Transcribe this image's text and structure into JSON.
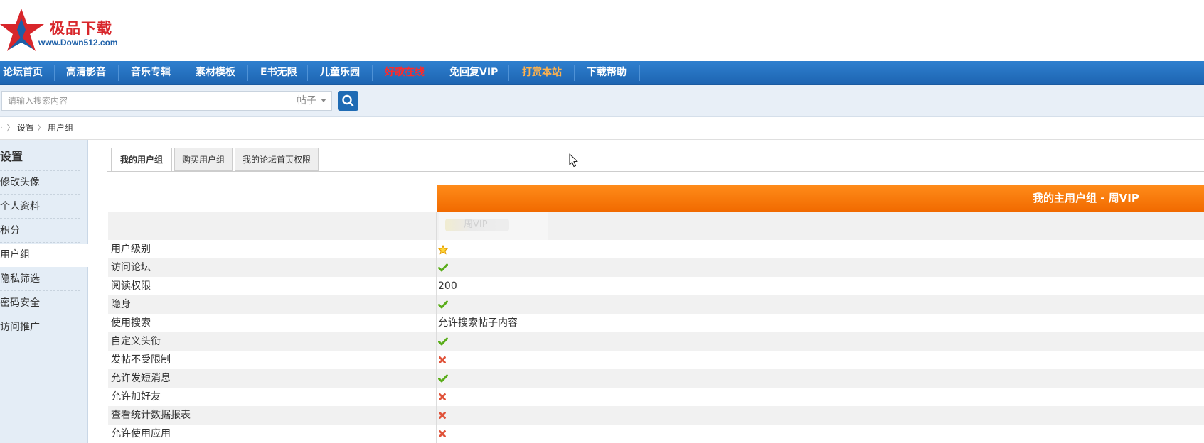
{
  "header": {
    "logo_text": "极品下载",
    "logo_url": "www.Down512.com"
  },
  "nav": {
    "items": [
      {
        "label": "论坛首页",
        "color": "#ffffff"
      },
      {
        "label": "高清影音",
        "color": "#ffffff"
      },
      {
        "label": "音乐专辑",
        "color": "#ffffff"
      },
      {
        "label": "素材模板",
        "color": "#ffffff"
      },
      {
        "label": "E书无限",
        "color": "#ffffff"
      },
      {
        "label": "儿童乐园",
        "color": "#ffffff"
      },
      {
        "label": "好歌在线",
        "color": "#ff2a2a"
      },
      {
        "label": "免回复VIP",
        "color": "#ffffff"
      },
      {
        "label": "打赏本站",
        "color": "#ffb24d"
      },
      {
        "label": "下载帮助",
        "color": "#ffffff"
      }
    ]
  },
  "search": {
    "placeholder": "请输入搜索内容",
    "type_label": "帖子",
    "button_icon": "search-icon"
  },
  "breadcrumb": {
    "items": [
      "设置",
      "用户组"
    ]
  },
  "sidebar": {
    "title": "设置",
    "items": [
      {
        "label": "修改头像"
      },
      {
        "label": "个人资料"
      },
      {
        "label": "积分"
      },
      {
        "label": "用户组"
      },
      {
        "label": "隐私筛选"
      },
      {
        "label": "密码安全"
      },
      {
        "label": "访问推广"
      }
    ],
    "active_index": 3
  },
  "tabs": [
    {
      "label": "我的用户组"
    },
    {
      "label": "购买用户组"
    },
    {
      "label": "我的论坛首页权限"
    }
  ],
  "group": {
    "header": "我的主用户组 - 周VIP",
    "name_blurred": "周VIP"
  },
  "permissions": [
    {
      "label": "用户级别",
      "value": "",
      "icon": "star-icon"
    },
    {
      "label": "访问论坛",
      "value": "",
      "icon": "check-icon"
    },
    {
      "label": "阅读权限",
      "value": "200",
      "icon": ""
    },
    {
      "label": "隐身",
      "value": "",
      "icon": "check-icon"
    },
    {
      "label": "使用搜索",
      "value": "允许搜索帖子内容",
      "icon": ""
    },
    {
      "label": "自定义头衔",
      "value": "",
      "icon": "check-icon"
    },
    {
      "label": "发帖不受限制",
      "value": "",
      "icon": "cross-icon"
    },
    {
      "label": "允许发短消息",
      "value": "",
      "icon": "check-icon"
    },
    {
      "label": "允许加好友",
      "value": "",
      "icon": "cross-icon"
    },
    {
      "label": "查看统计数据报表",
      "value": "",
      "icon": "cross-icon"
    },
    {
      "label": "允许使用应用",
      "value": "",
      "icon": "cross-icon"
    }
  ],
  "colors": {
    "nav_bg": "#2174c2",
    "orange_header": "#f57a0b",
    "check": "#5aad1a",
    "cross": "#e0533a",
    "star": "#f5b400"
  }
}
